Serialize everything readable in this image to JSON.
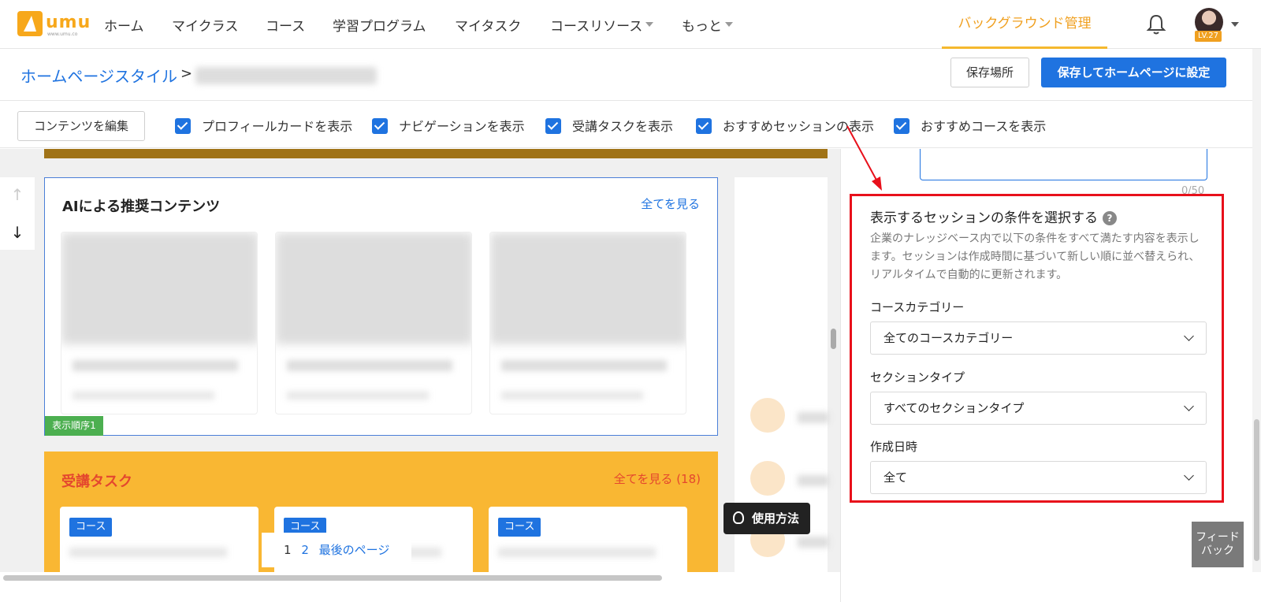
{
  "nav": {
    "logo_text": "umu",
    "logo_sub": "www.umu.co",
    "items": [
      "ホーム",
      "マイクラス",
      "コース",
      "学習プログラム",
      "マイタスク",
      "コースリソース",
      "もっと"
    ],
    "admin": "バックグラウンド管理",
    "level": "LV.27"
  },
  "breadcrumb": {
    "link": "ホームページスタイル",
    "sep": ">"
  },
  "actions": {
    "save_location": "保存場所",
    "save_home": "保存してホームページに設定"
  },
  "options": {
    "edit": "コンテンツを編集",
    "checks": [
      "プロフィールカードを表示",
      "ナビゲーションを表示",
      "受講タスクを表示",
      "おすすめセッションの表示",
      "おすすめコースを表示"
    ]
  },
  "ai": {
    "title": "AIによる推奨コンテンツ",
    "view_all": "全てを見る",
    "order_badge": "表示順序1"
  },
  "task": {
    "title": "受講タスク",
    "view_all": "全てを見る (18)",
    "tag": "コース"
  },
  "pager": {
    "p1": "1",
    "p2": "2",
    "last": "最後のページ"
  },
  "usage": "使用方法",
  "panel": {
    "counter": "0/50",
    "title": "表示するセッションの条件を選択する",
    "help": "?",
    "description": "企業のナレッジベース内で以下の条件をすべて満たす内容を表示します。セッションは作成時間に基づいて新しい順に並べ替えられ、リアルタイムで自動的に更新されます。",
    "category_label": "コースカテゴリー",
    "category_value": "全てのコースカテゴリー",
    "section_label": "セクションタイプ",
    "section_value": "すべてのセクションタイプ",
    "date_label": "作成日時",
    "date_value": "全て"
  },
  "feedback": "フィードバック",
  "colors": {
    "primary": "#1f73e0",
    "accent": "#f0a020",
    "highlight": "#e8101b"
  }
}
